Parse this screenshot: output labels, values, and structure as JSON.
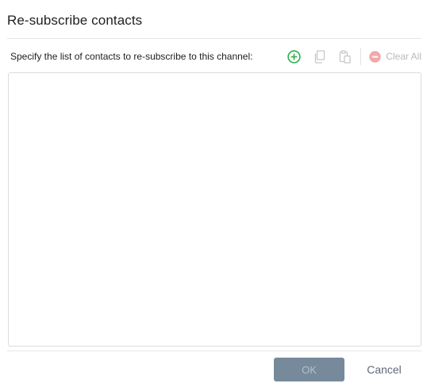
{
  "dialog": {
    "title": "Re-subscribe contacts",
    "instruction": "Specify the list of contacts to re-subscribe to this channel:"
  },
  "toolbar": {
    "add_icon": "plus-circle-icon",
    "copy_icon": "copy-icon",
    "paste_icon": "paste-icon",
    "clear_icon": "minus-circle-icon",
    "clear_label": "Clear All"
  },
  "contacts": [],
  "footer": {
    "ok_label": "OK",
    "cancel_label": "Cancel"
  },
  "colors": {
    "add": "#2bb24c",
    "disabled": "#c8c8c8",
    "clear": "#f2a8a8",
    "ok_bg": "#778a9b",
    "cancel": "#5d6a78"
  }
}
